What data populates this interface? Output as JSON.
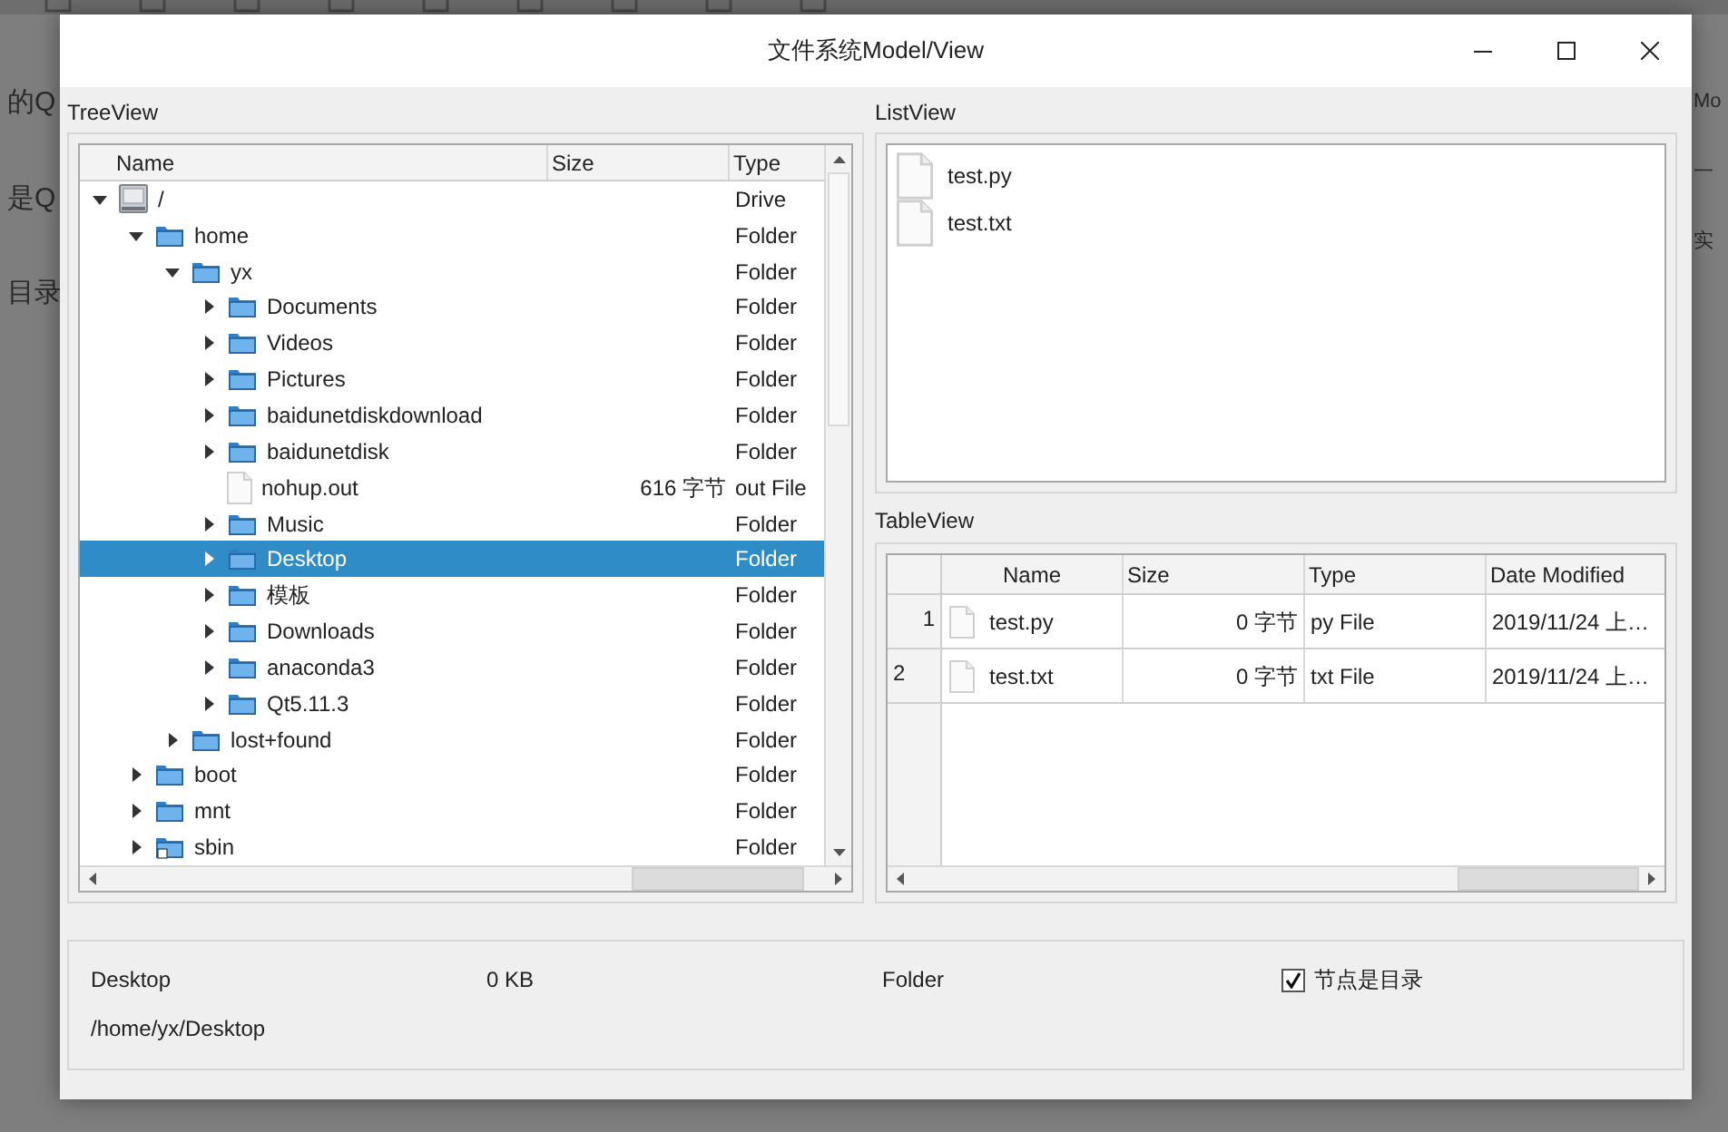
{
  "background": {
    "left_texts": [
      "的Q",
      "是Q",
      "目录"
    ],
    "right_texts": [
      "Mo",
      "一",
      "实"
    ]
  },
  "window": {
    "title": "文件系统Model/View"
  },
  "tree_view": {
    "label": "TreeView",
    "columns": [
      "Name",
      "Size",
      "Type"
    ],
    "items": [
      {
        "name": "/",
        "kind": "drive",
        "type": "Drive",
        "expanded": true,
        "selected": false,
        "children": [
          {
            "name": "home",
            "kind": "folder",
            "type": "Folder",
            "expanded": true,
            "selected": false,
            "children": [
              {
                "name": "yx",
                "kind": "folder",
                "type": "Folder",
                "expanded": true,
                "selected": false,
                "children": [
                  {
                    "name": "Documents",
                    "kind": "folder",
                    "type": "Folder",
                    "expanded": false,
                    "selected": false
                  },
                  {
                    "name": "Videos",
                    "kind": "folder",
                    "type": "Folder",
                    "expanded": false,
                    "selected": false
                  },
                  {
                    "name": "Pictures",
                    "kind": "folder",
                    "type": "Folder",
                    "expanded": false,
                    "selected": false
                  },
                  {
                    "name": "baidunetdiskdownload",
                    "kind": "folder",
                    "type": "Folder",
                    "expanded": false,
                    "selected": false
                  },
                  {
                    "name": "baidunetdisk",
                    "kind": "folder",
                    "type": "Folder",
                    "expanded": false,
                    "selected": false
                  },
                  {
                    "name": "nohup.out",
                    "kind": "file",
                    "size": "616 字节",
                    "type": "out File",
                    "selected": false
                  },
                  {
                    "name": "Music",
                    "kind": "folder",
                    "type": "Folder",
                    "expanded": false,
                    "selected": false
                  },
                  {
                    "name": "Desktop",
                    "kind": "folder",
                    "type": "Folder",
                    "expanded": false,
                    "selected": true
                  },
                  {
                    "name": "模板",
                    "kind": "folder",
                    "type": "Folder",
                    "expanded": false,
                    "selected": false
                  },
                  {
                    "name": "Downloads",
                    "kind": "folder",
                    "type": "Folder",
                    "expanded": false,
                    "selected": false
                  },
                  {
                    "name": "anaconda3",
                    "kind": "folder",
                    "type": "Folder",
                    "expanded": false,
                    "selected": false
                  },
                  {
                    "name": "Qt5.11.3",
                    "kind": "folder",
                    "type": "Folder",
                    "expanded": false,
                    "selected": false
                  }
                ]
              },
              {
                "name": "lost+found",
                "kind": "folder",
                "type": "Folder",
                "expanded": false,
                "selected": false
              }
            ]
          },
          {
            "name": "boot",
            "kind": "folder",
            "type": "Folder",
            "expanded": false,
            "selected": false
          },
          {
            "name": "mnt",
            "kind": "folder",
            "type": "Folder",
            "expanded": false,
            "selected": false
          },
          {
            "name": "sbin",
            "kind": "link",
            "type": "Folder",
            "expanded": false,
            "selected": false
          }
        ]
      }
    ]
  },
  "list_view": {
    "label": "ListView",
    "items": [
      "test.py",
      "test.txt"
    ]
  },
  "table_view": {
    "label": "TableView",
    "columns": [
      "Name",
      "Size",
      "Type",
      "Date Modified"
    ],
    "rows": [
      {
        "header": "1",
        "name": "test.py",
        "size": "0 字节",
        "type": "py File",
        "date": "2019/11/24 上…"
      },
      {
        "header": "2",
        "name": "test.txt",
        "size": "0 字节",
        "type": "txt File",
        "date": "2019/11/24 上…"
      }
    ]
  },
  "info": {
    "name": "Desktop",
    "size": "0 KB",
    "type": "Folder",
    "path": "/home/yx/Desktop",
    "is_dir": {
      "label": "节点是目录",
      "checked": true
    }
  }
}
